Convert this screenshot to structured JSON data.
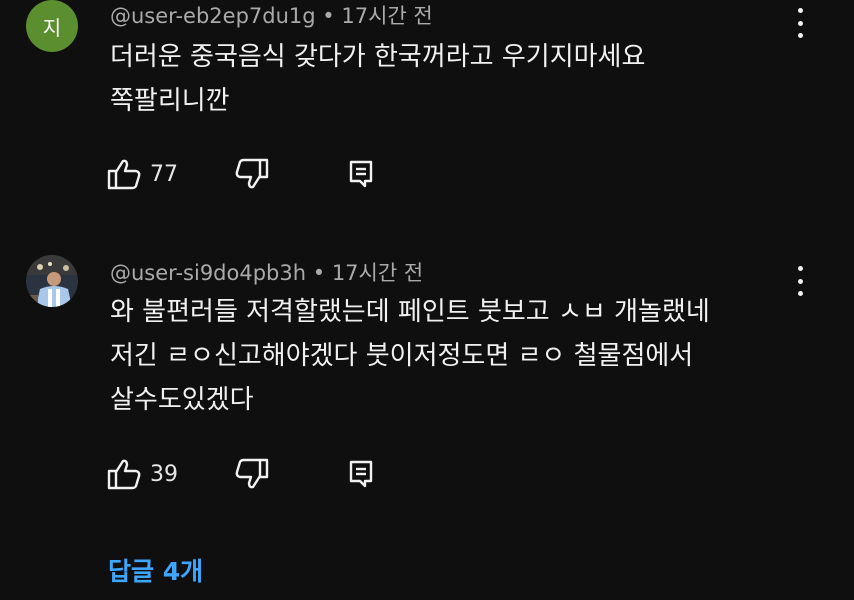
{
  "comments": [
    {
      "avatar_letter": "지",
      "avatar_color": "#5b8e2e",
      "username": "@user-eb2ep7du1g",
      "separator": "•",
      "time": "17시간 전",
      "lines": [
        "더러운 중국음식 갖다가 한국꺼라고 우기지마세요",
        "쪽팔리니깐"
      ],
      "likes": "77"
    },
    {
      "avatar_image": "user-photo-avatar",
      "username": "@user-si9do4pb3h",
      "separator": "•",
      "time": "17시간 전",
      "lines": [
        "와 불편러들 저격할랬는데 페인트 붓보고 ㅅㅂ 개놀랬네",
        "저긴 ㄹㅇ신고해야겠다 붓이저정도면 ㄹㅇ 철물점에서",
        "살수도있겠다"
      ],
      "likes": "39"
    }
  ],
  "replies_label": "답글 4개",
  "icons": {
    "like": "thumbs-up-icon",
    "dislike": "thumbs-down-icon",
    "reply": "reply-icon",
    "more": "more-vert-icon"
  },
  "colors": {
    "background": "#0f0f0f",
    "link": "#3ea6ff",
    "meta": "#aaaaaa"
  }
}
